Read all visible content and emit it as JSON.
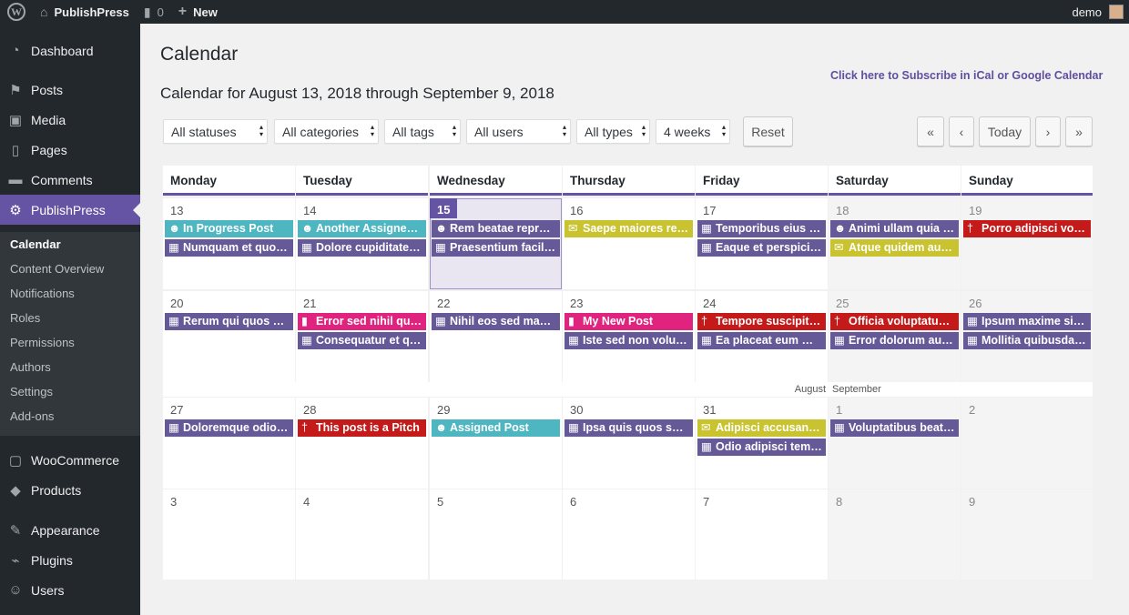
{
  "adminbar": {
    "wp_logo": "W",
    "site_name": "PublishPress",
    "comments_count": "0",
    "new_label": "New",
    "user": "demo",
    "icons": {
      "home": "home-icon",
      "comments": "comment-bubble-icon",
      "new": "plus-icon"
    }
  },
  "sidebar": {
    "items": [
      {
        "label": "Dashboard",
        "icon": "dashboard-icon"
      },
      {
        "label": "Posts",
        "icon": "pin-icon"
      },
      {
        "label": "Media",
        "icon": "media-icon"
      },
      {
        "label": "Pages",
        "icon": "pages-icon"
      },
      {
        "label": "Comments",
        "icon": "comments-icon"
      },
      {
        "label": "PublishPress",
        "icon": "publishpress-icon"
      },
      {
        "label": "WooCommerce",
        "icon": "woo-icon"
      },
      {
        "label": "Products",
        "icon": "products-icon"
      },
      {
        "label": "Appearance",
        "icon": "brush-icon"
      },
      {
        "label": "Plugins",
        "icon": "plug-icon"
      },
      {
        "label": "Users",
        "icon": "users-icon"
      }
    ],
    "submenu": [
      "Calendar",
      "Content Overview",
      "Notifications",
      "Roles",
      "Permissions",
      "Authors",
      "Settings",
      "Add-ons"
    ]
  },
  "page": {
    "title": "Calendar",
    "range_title": "Calendar for August 13, 2018 through September 9, 2018",
    "subscribe_link": "Click here to Subscribe in iCal or Google Calendar"
  },
  "filters": {
    "status": "All statuses",
    "categories": "All categories",
    "tags": "All tags",
    "users": "All users",
    "types": "All types",
    "weeks": "4 weeks",
    "reset": "Reset"
  },
  "nav": {
    "first": "«",
    "prev": "‹",
    "today": "Today",
    "next": "›",
    "last": "»"
  },
  "colors": {
    "purple": "#655997",
    "teal": "#4db6c1",
    "red": "#c41a1a",
    "yellow": "#c8c32f",
    "pink": "#e0237f",
    "accent": "#6553a3"
  },
  "calendar": {
    "days": [
      "Monday",
      "Tuesday",
      "Wednesday",
      "Thursday",
      "Friday",
      "Saturday",
      "Sunday"
    ],
    "month_separator": {
      "left": "August",
      "right": "September"
    },
    "weeks": [
      [
        {
          "date": "13",
          "events": [
            {
              "title": "In Progress Post",
              "color": "teal",
              "icon": "user-icon"
            },
            {
              "title": "Numquam et quos aut",
              "color": "purple",
              "icon": "calendar-icon"
            }
          ]
        },
        {
          "date": "14",
          "events": [
            {
              "title": "Another Assigned Post",
              "color": "teal",
              "icon": "user-icon"
            },
            {
              "title": "Dolore cupiditate sunt",
              "color": "purple",
              "icon": "calendar-icon"
            }
          ]
        },
        {
          "date": "15",
          "today": true,
          "events": [
            {
              "title": "Rem beatae reprehenderit",
              "color": "purple",
              "icon": "user-icon"
            },
            {
              "title": "Praesentium facilis quia",
              "color": "purple",
              "icon": "calendar-icon"
            }
          ]
        },
        {
          "date": "16",
          "events": [
            {
              "title": "Saepe maiores rem quia",
              "color": "yellow",
              "icon": "comment-icon"
            }
          ]
        },
        {
          "date": "17",
          "events": [
            {
              "title": "Temporibus eius placeat",
              "color": "purple",
              "icon": "calendar-icon"
            },
            {
              "title": "Eaque et perspiciatis",
              "color": "purple",
              "icon": "calendar-icon"
            }
          ]
        },
        {
          "date": "18",
          "weekend": true,
          "events": [
            {
              "title": "Animi ullam quia fugit",
              "color": "purple",
              "icon": "user-icon"
            },
            {
              "title": "Atque quidem aut est",
              "color": "yellow",
              "icon": "comment-icon"
            }
          ]
        },
        {
          "date": "19",
          "weekend": true,
          "events": [
            {
              "title": "Porro adipisci voluptas",
              "color": "red",
              "icon": "pin-icon"
            }
          ]
        }
      ],
      [
        {
          "date": "20",
          "events": [
            {
              "title": "Rerum qui quos quia",
              "color": "purple",
              "icon": "calendar-icon"
            }
          ]
        },
        {
          "date": "21",
          "events": [
            {
              "title": "Error sed nihil quis et",
              "color": "pink",
              "icon": "document-icon"
            },
            {
              "title": "Consequatur et quia",
              "color": "purple",
              "icon": "calendar-icon"
            }
          ]
        },
        {
          "date": "22",
          "events": [
            {
              "title": "Nihil eos sed magnam",
              "color": "purple",
              "icon": "calendar-icon"
            }
          ]
        },
        {
          "date": "23",
          "events": [
            {
              "title": "My New Post",
              "color": "pink",
              "icon": "document-icon"
            },
            {
              "title": "Iste sed non voluptas",
              "color": "purple",
              "icon": "calendar-icon"
            }
          ]
        },
        {
          "date": "24",
          "events": [
            {
              "title": "Tempore suscipit dolor",
              "color": "red",
              "icon": "pin-icon"
            },
            {
              "title": "Ea placeat eum modi",
              "color": "purple",
              "icon": "calendar-icon"
            }
          ]
        },
        {
          "date": "25",
          "weekend": true,
          "events": [
            {
              "title": "Officia voluptatum quia",
              "color": "red",
              "icon": "pin-icon"
            },
            {
              "title": "Error dolorum autem",
              "color": "purple",
              "icon": "calendar-icon"
            }
          ]
        },
        {
          "date": "26",
          "weekend": true,
          "events": [
            {
              "title": "Ipsum maxime sit et",
              "color": "purple",
              "icon": "calendar-icon"
            },
            {
              "title": "Mollitia quibusdam et",
              "color": "purple",
              "icon": "calendar-icon"
            }
          ]
        }
      ],
      [
        {
          "date": "27",
          "events": [
            {
              "title": "Doloremque odio aut",
              "color": "purple",
              "icon": "calendar-icon"
            }
          ]
        },
        {
          "date": "28",
          "events": [
            {
              "title": "This post is a Pitch",
              "color": "red",
              "icon": "pin-icon"
            }
          ]
        },
        {
          "date": "29",
          "events": [
            {
              "title": "Assigned Post",
              "color": "teal",
              "icon": "user-icon"
            }
          ]
        },
        {
          "date": "30",
          "events": [
            {
              "title": "Ipsa quis quos saepe",
              "color": "purple",
              "icon": "calendar-icon"
            }
          ]
        },
        {
          "date": "31",
          "events": [
            {
              "title": "Adipisci accusantium",
              "color": "yellow",
              "icon": "comment-icon"
            },
            {
              "title": "Odio adipisci tempore",
              "color": "purple",
              "icon": "calendar-icon"
            }
          ]
        },
        {
          "date": "1",
          "weekend": true,
          "events": [
            {
              "title": "Voluptatibus beatae",
              "color": "purple",
              "icon": "calendar-icon"
            }
          ]
        },
        {
          "date": "2",
          "weekend": true,
          "events": []
        }
      ],
      [
        {
          "date": "3",
          "events": []
        },
        {
          "date": "4",
          "events": []
        },
        {
          "date": "5",
          "events": []
        },
        {
          "date": "6",
          "events": []
        },
        {
          "date": "7",
          "events": []
        },
        {
          "date": "8",
          "weekend": true,
          "events": []
        },
        {
          "date": "9",
          "weekend": true,
          "events": []
        }
      ]
    ]
  }
}
